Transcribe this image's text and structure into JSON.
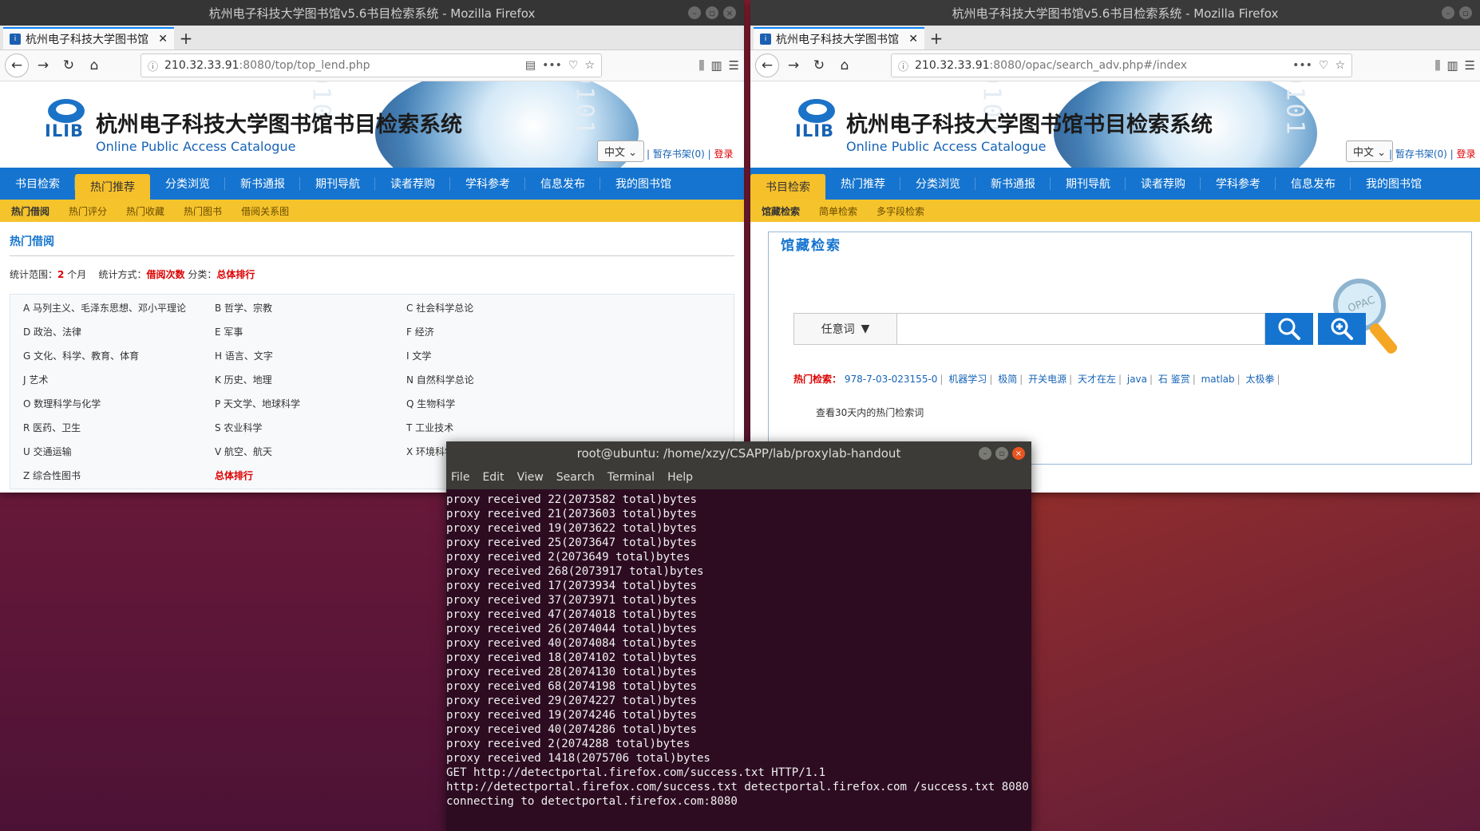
{
  "left_window": {
    "title": "杭州电子科技大学图书馆v5.6书目检索系统 - Mozilla Firefox",
    "tab_title": "杭州电子科技大学图书馆",
    "url_host": "210.32.33.91",
    "url_rest": ":8080/top/top_lend.php",
    "brand_cn": "杭州电子科技大学图书馆书目检索系统",
    "brand_en": "Online Public Access Catalogue",
    "logo_text": "ILIB",
    "lang": "中文",
    "shelf_link": "暂存书架(0)",
    "login_link": "登录",
    "menu": [
      "书目检索",
      "热门推荐",
      "分类浏览",
      "新书通报",
      "期刊导航",
      "读者荐购",
      "学科参考",
      "信息发布",
      "我的图书馆"
    ],
    "submenu": [
      "热门借阅",
      "热门评分",
      "热门收藏",
      "热门图书",
      "借阅关系图"
    ],
    "section_title": "热门借阅",
    "stats": {
      "range_label": "统计范围：",
      "range_value": "2",
      "range_unit": " 个月",
      "method_label": "统计方式：",
      "method_value": "借阅次数",
      "class_label": " 分类：",
      "class_value": "总体排行"
    },
    "categories": [
      "A 马列主义、毛泽东思想、邓小平理论",
      "B 哲学、宗教",
      "C 社会科学总论",
      "D 政治、法律",
      "E 军事",
      "F 经济",
      "G 文化、科学、教育、体育",
      "H 语言、文字",
      "I 文学",
      "J 艺术",
      "K 历史、地理",
      "N 自然科学总论",
      "O 数理科学与化学",
      "P 天文学、地球科学",
      "Q 生物科学",
      "R 医药、卫生",
      "S 农业科学",
      "T 工业技术",
      "U 交通运输",
      "V 航空、航天",
      "X 环境科学、安全科学",
      "Z 综合性图书",
      "总体排行",
      ""
    ]
  },
  "right_window": {
    "title": "杭州电子科技大学图书馆v5.6书目检索系统 - Mozilla Firefox",
    "tab_title": "杭州电子科技大学图书馆",
    "url_host": "210.32.33.91",
    "url_rest": ":8080/opac/search_adv.php#/index",
    "brand_cn": "杭州电子科技大学图书馆书目检索系统",
    "brand_en": "Online Public Access Catalogue",
    "logo_text": "ILIB",
    "lang": "中文",
    "shelf_link": "暂存书架(0)",
    "login_link": "登录",
    "menu": [
      "书目检索",
      "热门推荐",
      "分类浏览",
      "新书通报",
      "期刊导航",
      "读者荐购",
      "学科参考",
      "信息发布",
      "我的图书馆"
    ],
    "submenu": [
      "馆藏检索",
      "简单检索",
      "多字段检索"
    ],
    "box_legend": "馆藏检索",
    "search_type": "任意词",
    "search_value": "",
    "hot_label": "热门检索：",
    "hot_terms": [
      "978-7-03-023155-0",
      "机器学习",
      "极简",
      "开关电源",
      "天才在左",
      "java",
      "石 鉴赏",
      "matlab",
      "太极拳"
    ],
    "hot_note": "查看30天内的热门检索词"
  },
  "terminal": {
    "title": "root@ubuntu: /home/xzy/CSAPP/lab/proxylab-handout",
    "menu": [
      "File",
      "Edit",
      "View",
      "Search",
      "Terminal",
      "Help"
    ],
    "lines": [
      "proxy received 22(2073582 total)bytes",
      "proxy received 21(2073603 total)bytes",
      "proxy received 19(2073622 total)bytes",
      "proxy received 25(2073647 total)bytes",
      "proxy received 2(2073649 total)bytes",
      "proxy received 268(2073917 total)bytes",
      "proxy received 17(2073934 total)bytes",
      "proxy received 37(2073971 total)bytes",
      "proxy received 47(2074018 total)bytes",
      "proxy received 26(2074044 total)bytes",
      "proxy received 40(2074084 total)bytes",
      "proxy received 18(2074102 total)bytes",
      "proxy received 28(2074130 total)bytes",
      "proxy received 68(2074198 total)bytes",
      "proxy received 29(2074227 total)bytes",
      "proxy received 19(2074246 total)bytes",
      "proxy received 40(2074286 total)bytes",
      "proxy received 2(2074288 total)bytes",
      "proxy received 1418(2075706 total)bytes",
      "GET http://detectportal.firefox.com/success.txt HTTP/1.1",
      "http://detectportal.firefox.com/success.txt detectportal.firefox.com /success.txt 8080",
      "connecting to detectportal.firefox.com:8080"
    ]
  }
}
